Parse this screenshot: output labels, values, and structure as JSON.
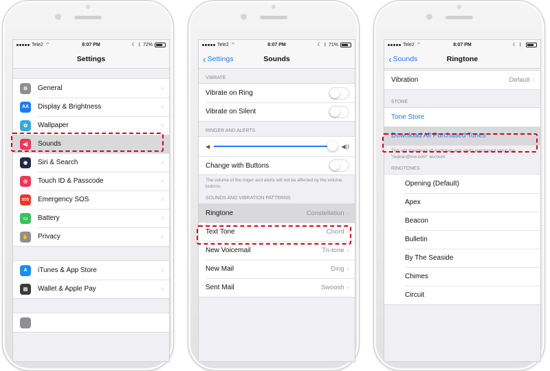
{
  "status_bar": {
    "carrier": "Tele2",
    "time": "8:07 PM",
    "battery_phone1": "72%",
    "battery_phone2": "71%",
    "battery_phone3": ""
  },
  "phone1": {
    "title": "Settings",
    "items": [
      {
        "label": "General",
        "icon": "gear-icon",
        "color": "#8e8e93"
      },
      {
        "label": "Display & Brightness",
        "icon": "display-icon",
        "color": "#1a7cf5"
      },
      {
        "label": "Wallpaper",
        "icon": "wallpaper-icon",
        "color": "#35aadc"
      },
      {
        "label": "Sounds",
        "icon": "speaker-icon",
        "color": "#f0365a"
      },
      {
        "label": "Siri & Search",
        "icon": "siri-icon",
        "color": "#222a44"
      },
      {
        "label": "Touch ID & Passcode",
        "icon": "fingerprint-icon",
        "color": "#f0365a"
      },
      {
        "label": "Emergency SOS",
        "icon": "sos-icon",
        "color": "#e8392c"
      },
      {
        "label": "Battery",
        "icon": "battery-icon",
        "color": "#3ac05b"
      },
      {
        "label": "Privacy",
        "icon": "hand-icon",
        "color": "#8e8e93"
      }
    ],
    "items2": [
      {
        "label": "iTunes & App Store",
        "icon": "app-store-icon",
        "color": "#1a8cf5"
      },
      {
        "label": "Wallet & Apple Pay",
        "icon": "wallet-icon",
        "color": "#3a3a3c"
      }
    ]
  },
  "phone2": {
    "back": "Settings",
    "title": "Sounds",
    "vibrate_header": "VIBRATE",
    "vibrate_on_ring": "Vibrate on Ring",
    "vibrate_on_silent": "Vibrate on Silent",
    "ringer_header": "RINGER AND ALERTS",
    "volume_level": 0.96,
    "change_with_buttons": "Change with Buttons",
    "ringer_note": "The volume of the ringer and alerts will not be affected by the volume buttons.",
    "patterns_header": "SOUNDS AND VIBRATION PATTERNS",
    "patterns": [
      {
        "label": "Ringtone",
        "value": "Constellation"
      },
      {
        "label": "Text Tone",
        "value": "Chord"
      },
      {
        "label": "New Voicemail",
        "value": "Tri-tone"
      },
      {
        "label": "New Mail",
        "value": "Ding"
      },
      {
        "label": "Sent Mail",
        "value": "Swoosh"
      }
    ]
  },
  "phone3": {
    "back": "Sounds",
    "title": "Ringtone",
    "vibration_label": "Vibration",
    "vibration_value": "Default",
    "store_header": "STORE",
    "tone_store": "Tone Store",
    "download_all": "Download All Purchased Tones",
    "download_note": "This will download all ringtones and alerts purchased using the \"dujkan@me.com\" account.",
    "ringtones_header": "RINGTONES",
    "ringtones": [
      "Opening (Default)",
      "Apex",
      "Beacon",
      "Bulletin",
      "By The Seaside",
      "Chimes",
      "Circuit"
    ]
  },
  "highlight_color": "#d0021b",
  "accent_color": "#1a7cf5"
}
